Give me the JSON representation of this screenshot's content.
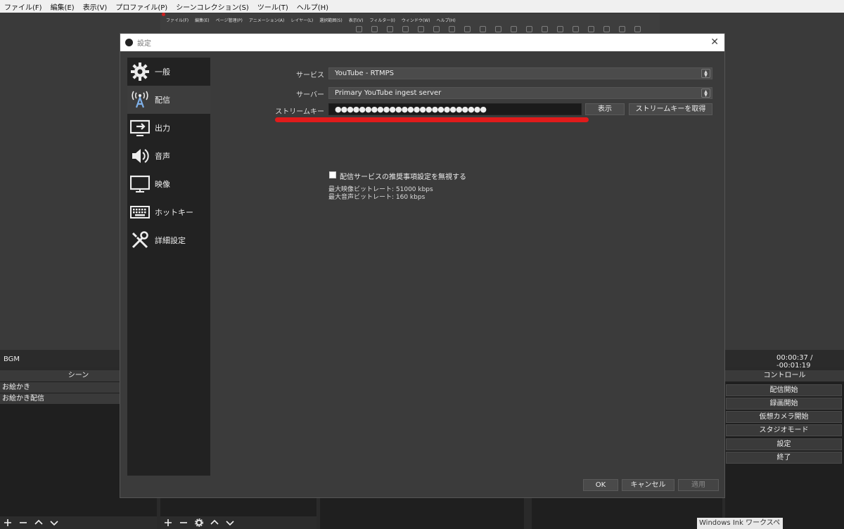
{
  "obs_menu": [
    "ファイル(F)",
    "編集(E)",
    "表示(V)",
    "プロファイル(P)",
    "シーンコレクション(S)",
    "ツール(T)",
    "ヘルプ(H)"
  ],
  "csp_menu": [
    "ファイル(F)",
    "編集(E)",
    "ページ管理(P)",
    "アニメーション(A)",
    "レイヤー(L)",
    "選択範囲(S)",
    "表示(V)",
    "フィルター(I)",
    "ウィンドウ(W)",
    "ヘルプ(H)"
  ],
  "dialog": {
    "title": "設定",
    "close": "✕",
    "nav": [
      {
        "label": "一般",
        "icon": "gear-icon"
      },
      {
        "label": "配信",
        "icon": "antenna-icon"
      },
      {
        "label": "出力",
        "icon": "output-icon"
      },
      {
        "label": "音声",
        "icon": "speaker-icon"
      },
      {
        "label": "映像",
        "icon": "monitor-icon"
      },
      {
        "label": "ホットキー",
        "icon": "keyboard-icon"
      },
      {
        "label": "詳細設定",
        "icon": "tools-icon"
      }
    ],
    "active_nav": "配信",
    "service_label": "サービス",
    "service_value": "YouTube - RTMPS",
    "server_label": "サーバー",
    "server_value": "Primary YouTube ingest server",
    "key_label": "ストリームキー",
    "key_value": "●●●●●●●●●●●●●●●●●●●●●●●●●",
    "show_button": "表示",
    "get_key_button": "ストリームキーを取得",
    "ignore_checkbox": "配信サービスの推奨事項設定を無視する",
    "ignore_checked": false,
    "max_video_bitrate": "最大映像ビットレート: 51000 kbps",
    "max_audio_bitrate": "最大音声ビットレート: 160 kbps",
    "ok": "OK",
    "cancel": "キャンセル",
    "apply": "適用",
    "highlight_color": "#e01b1b"
  },
  "bottom": {
    "bgm": "BGM",
    "time": "00:00:37 / -00:01:19",
    "scenes_header": "シーン",
    "scenes": [
      "お絵かき",
      "お絵かき配信"
    ],
    "controls_header": "コントロール",
    "controls": [
      "配信開始",
      "録画開始",
      "仮想カメラ開始",
      "スタジオモード",
      "設定",
      "終了"
    ],
    "windows_ink": "Windows Ink ワークスペース"
  }
}
